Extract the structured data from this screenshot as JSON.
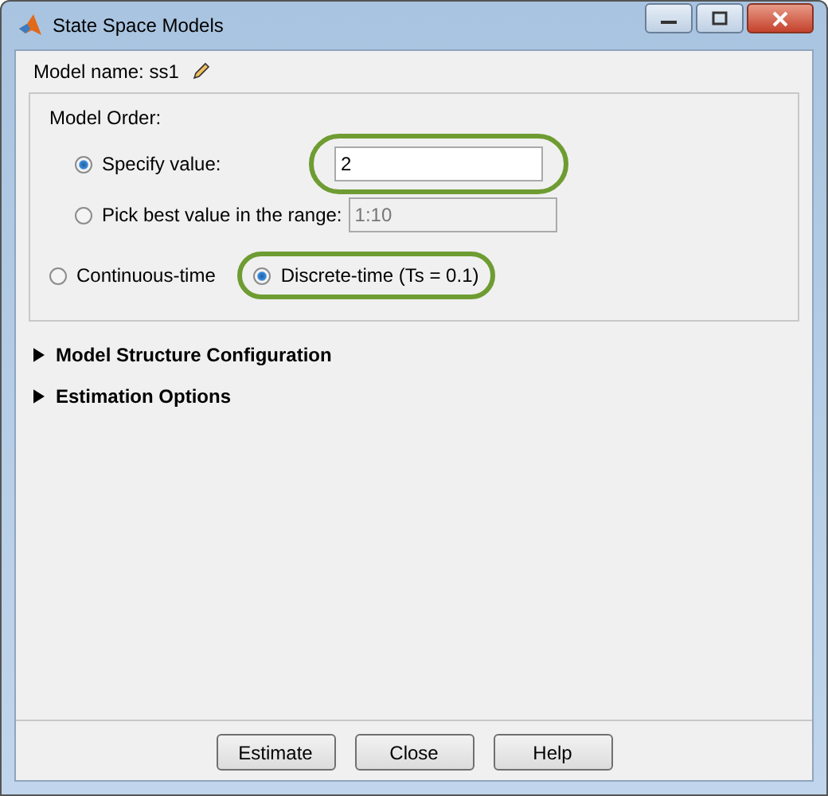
{
  "window": {
    "title": "State Space Models"
  },
  "model_name": {
    "label": "Model name: ss1"
  },
  "model_order": {
    "label": "Model Order:",
    "options": [
      {
        "label": "Specify value:",
        "selected": true,
        "value": "2",
        "disabled": false,
        "highlighted": true
      },
      {
        "label": "Pick best value in the range:",
        "selected": false,
        "value": "1:10",
        "disabled": true,
        "highlighted": false
      }
    ]
  },
  "time_domain": [
    {
      "label": "Continuous-time",
      "selected": false,
      "highlighted": false
    },
    {
      "label": "Discrete-time (Ts = 0.1)",
      "selected": true,
      "highlighted": true
    }
  ],
  "sections": [
    {
      "label": "Model Structure Configuration",
      "expanded": false
    },
    {
      "label": "Estimation Options",
      "expanded": false
    }
  ],
  "buttons": [
    "Estimate",
    "Close",
    "Help"
  ]
}
